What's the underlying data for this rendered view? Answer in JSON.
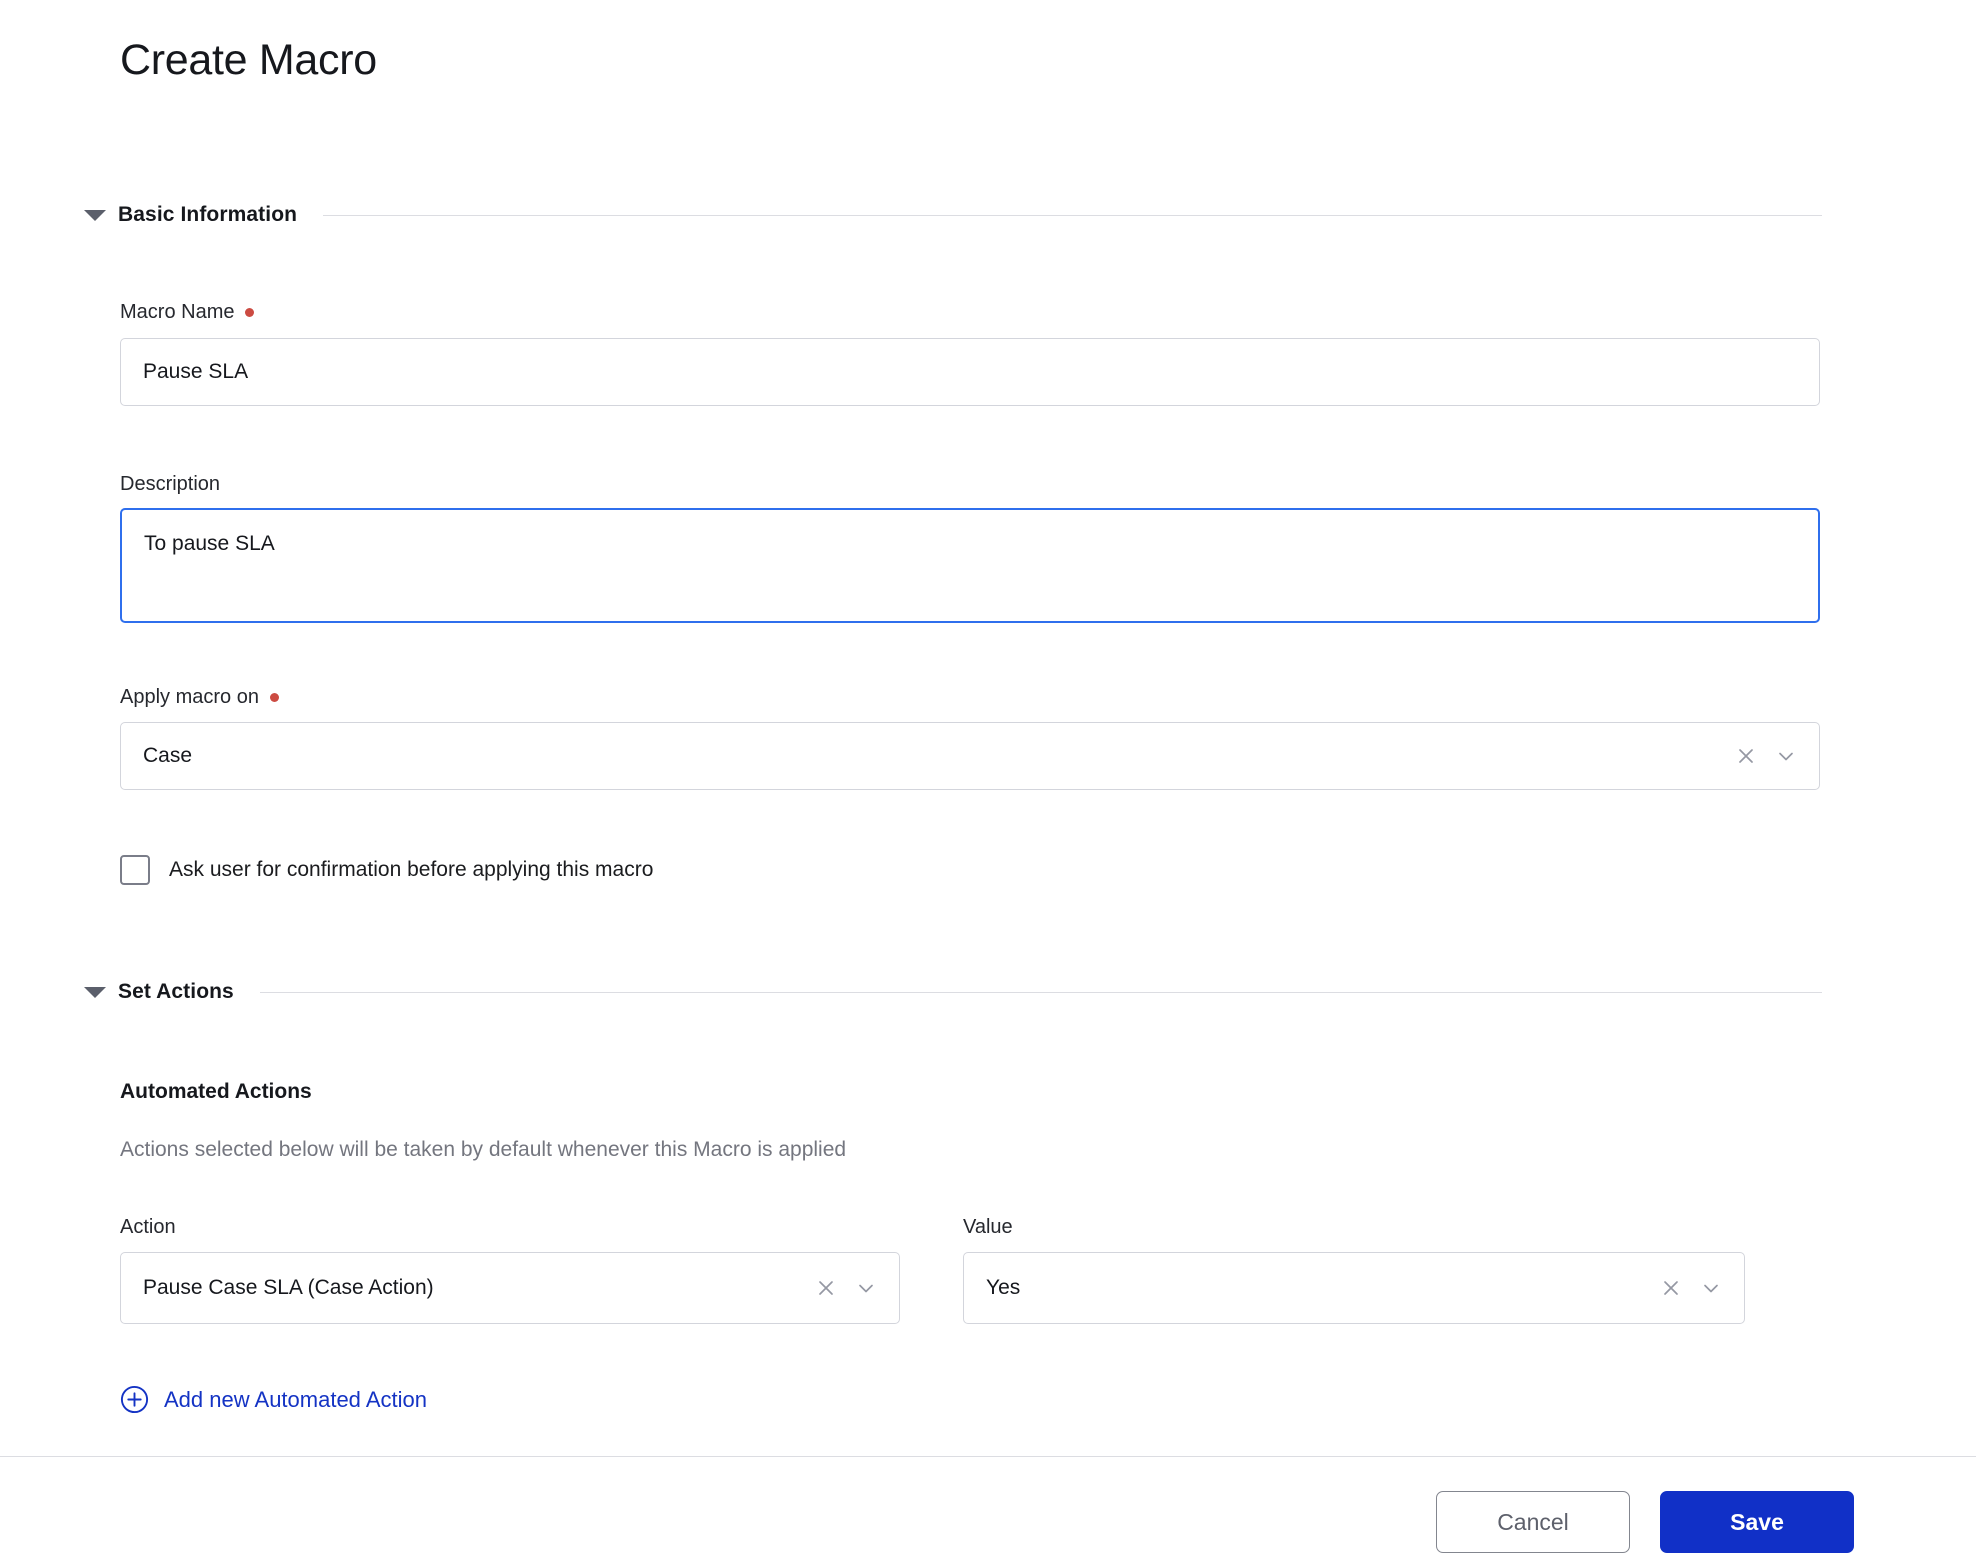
{
  "page": {
    "title": "Create Macro"
  },
  "sections": {
    "basic": {
      "title": "Basic Information",
      "caret_icon": "caret-down-icon"
    },
    "actions": {
      "title": "Set Actions",
      "caret_icon": "caret-down-icon"
    }
  },
  "fields": {
    "macro_name": {
      "label": "Macro Name",
      "required": true,
      "value": "Pause SLA",
      "placeholder": ""
    },
    "description": {
      "label": "Description",
      "required": false,
      "value": "To pause SLA",
      "placeholder": "",
      "focused": true
    },
    "apply_macro_on": {
      "label": "Apply macro on",
      "required": true,
      "value": "Case",
      "clear_icon": "close-icon",
      "dropdown_icon": "chevron-down-icon"
    },
    "confirmation_checkbox": {
      "label": "Ask user for confirmation before applying this macro",
      "checked": false
    }
  },
  "automated_actions": {
    "heading": "Automated Actions",
    "subtext": "Actions selected below will be taken by default whenever this Macro is applied",
    "columns": {
      "action": "Action",
      "value": "Value"
    },
    "rows": [
      {
        "action": "Pause Case SLA (Case Action)",
        "value": "Yes",
        "clear_icon": "close-icon",
        "dropdown_icon": "chevron-down-icon"
      }
    ],
    "add_link": {
      "label": "Add new Automated Action",
      "icon": "plus-circle-icon"
    }
  },
  "footer": {
    "cancel_label": "Cancel",
    "save_label": "Save"
  },
  "colors": {
    "primary": "#1130c7",
    "link": "#1433c4",
    "focus_border": "#2f6fed",
    "required_dot": "#cc4b42",
    "border": "#d3d5dc",
    "muted_text": "#74767f"
  }
}
